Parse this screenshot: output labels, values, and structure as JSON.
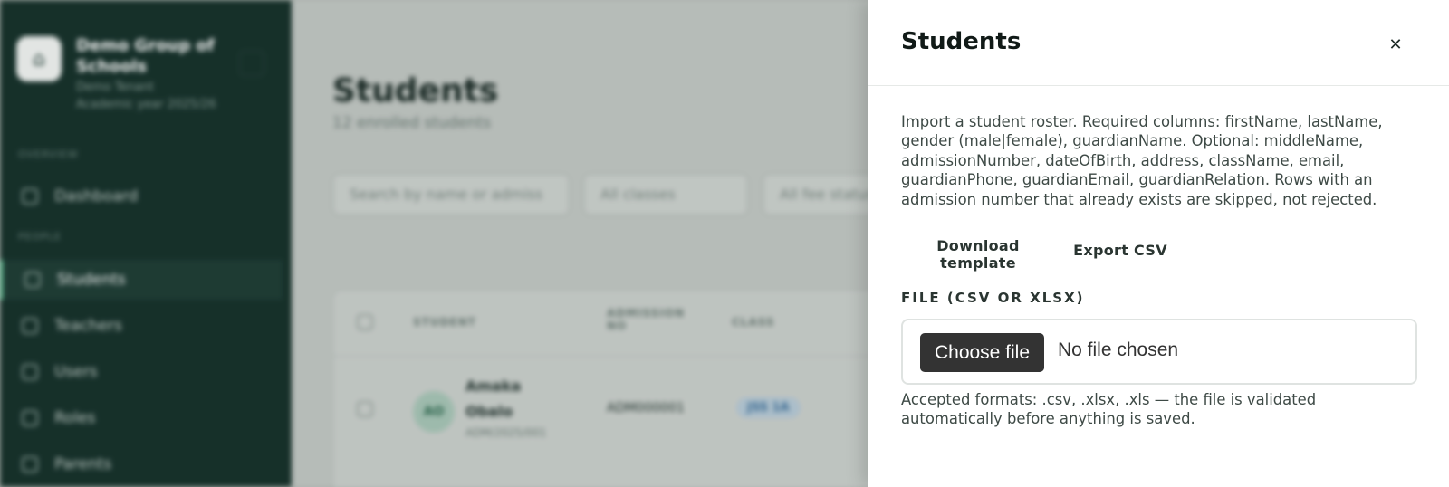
{
  "sidebar": {
    "school_name": "Demo Group of Schools",
    "school_sub": "Demo Tenant",
    "school_sub2": "Academic year 2025/26",
    "logo_glyph": "⌂",
    "section_overview": "OVERVIEW",
    "section_people": "PEOPLE",
    "items": [
      {
        "label": "Dashboard",
        "icon": "dashboard-icon"
      },
      {
        "label": "Students",
        "icon": "student-icon"
      },
      {
        "label": "Teachers",
        "icon": "teacher-icon"
      },
      {
        "label": "Users",
        "icon": "users-icon"
      },
      {
        "label": "Roles",
        "icon": "roles-icon"
      },
      {
        "label": "Parents",
        "icon": "parents-icon"
      }
    ]
  },
  "main": {
    "title": "Students",
    "subtitle": "12 enrolled students",
    "search_placeholder": "Search by name or admiss",
    "class_filter": "All classes",
    "status_filter": "All fee statuses",
    "columns": {
      "student": "STUDENT",
      "admission": "ADMISSION NO",
      "class": "CLASS"
    },
    "row": {
      "initials": "AO",
      "first": "Amaka",
      "last": "Obalo",
      "sub": "ADM/2025/001",
      "admission_no": "ADM000001",
      "class": "JSS 1A"
    }
  },
  "drawer": {
    "title": "Students",
    "close_glyph": "✕",
    "description": "Import a student roster. Required columns: firstName, lastName, gender (male|female), guardianName. Optional: middleName, admissionNumber, dateOfBirth, address, className, email, guardianPhone, guardianEmail, guardianRelation. Rows with an admission number that already exists are skipped, not rejected.",
    "download_template": "Download template",
    "export_csv": "Export CSV",
    "file_label": "FILE (CSV OR XLSX)",
    "choose_file": "Choose file",
    "no_file": "No file chosen",
    "help": "Accepted formats: .csv, .xlsx, .xls — the file is validated automatically before anything is saved."
  }
}
